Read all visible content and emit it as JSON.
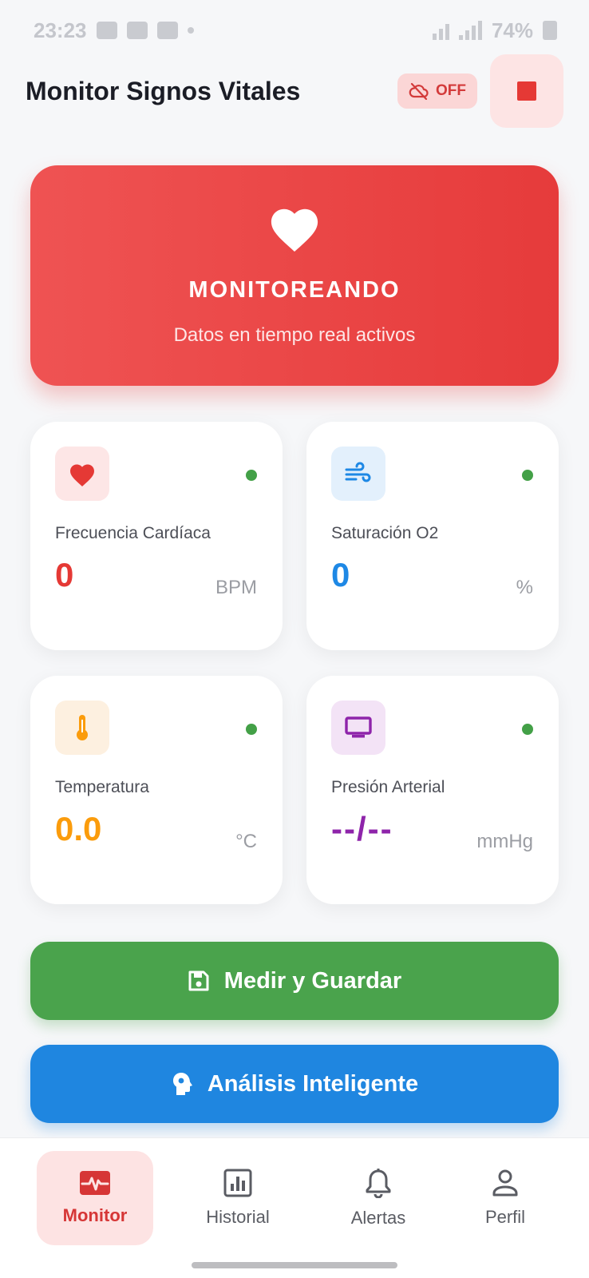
{
  "status_bar": {
    "time": "23:23",
    "battery": "74%"
  },
  "header": {
    "title": "Monitor Signos Vitales",
    "cloud_status": "OFF"
  },
  "hero": {
    "title": "MONITOREANDO",
    "subtitle": "Datos en tiempo real activos"
  },
  "vitals": {
    "heart_rate": {
      "label": "Frecuencia Cardíaca",
      "value": "0",
      "unit": "BPM",
      "color": "#e53935",
      "icon": "heart-icon"
    },
    "oxygen": {
      "label": "Saturación O2",
      "value": "0",
      "unit": "%",
      "color": "#1e88e5",
      "icon": "wind-icon"
    },
    "temperature": {
      "label": "Temperatura",
      "value": "0.0",
      "unit": "°C",
      "color": "#fb9c0c",
      "icon": "thermometer-icon"
    },
    "blood_pressure": {
      "label": "Presión Arterial",
      "value": "--/--",
      "unit": "mmHg",
      "color": "#8e24aa",
      "icon": "monitor-icon"
    }
  },
  "actions": {
    "save_label": "Medir y Guardar",
    "analysis_label": "Análisis Inteligente"
  },
  "nav": {
    "items": [
      {
        "label": "Monitor",
        "icon": "monitor-heart-icon",
        "active": true
      },
      {
        "label": "Historial",
        "icon": "chart-icon",
        "active": false
      },
      {
        "label": "Alertas",
        "icon": "bell-icon",
        "active": false
      },
      {
        "label": "Perfil",
        "icon": "person-icon",
        "active": false
      }
    ]
  },
  "colors": {
    "accent_red": "#e53935",
    "status_green": "#43a047",
    "button_green": "#4aa34c",
    "button_blue": "#1f86e0"
  }
}
